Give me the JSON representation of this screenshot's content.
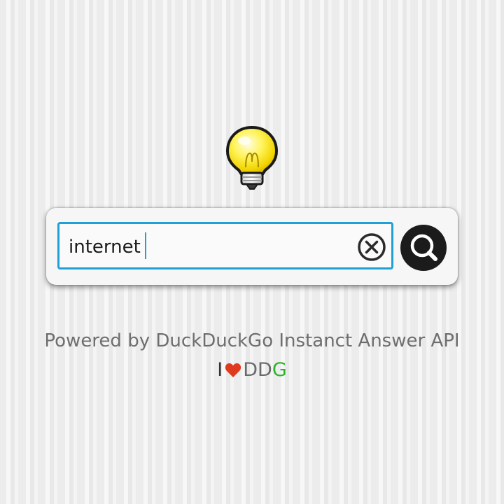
{
  "search": {
    "value": "internet",
    "clear_icon": "clear-x-circle-icon",
    "submit_icon": "magnifier-icon",
    "focus_color": "#1fa0d6"
  },
  "header": {
    "logo_icon": "lightbulb-icon"
  },
  "footer": {
    "powered_text": "Powered by DuckDuckGo Instanct Answer API",
    "love_prefix": "I",
    "love_icon": "heart-icon",
    "love_dd": "DD",
    "love_g": "G",
    "heart_color": "#e03a1e",
    "g_color": "#2db32d"
  }
}
